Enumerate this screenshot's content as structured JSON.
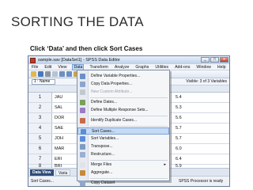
{
  "slide": {
    "title": "SORTING THE DATA",
    "subtitle": "Click ‘Data’ and then click Sort Cases"
  },
  "window": {
    "title": "sample.sav [DataSet1] - SPSS Data Editor",
    "controls": [
      "_",
      "□",
      "x"
    ]
  },
  "menubar": [
    "File",
    "Edit",
    "View",
    "Data",
    "Transform",
    "Analyze",
    "Graphs",
    "Utilities",
    "Add-ons",
    "Window",
    "Help"
  ],
  "active_menu": "Data",
  "cellref": {
    "value": "1 : Name",
    "visible": "Visible: 3 of 3 Variables"
  },
  "rows": [
    {
      "num": "1",
      "name": "JAU",
      "value": "5.4"
    },
    {
      "num": "2",
      "name": "SAL",
      "value": "5.3"
    },
    {
      "num": "3",
      "name": "DOR",
      "value": "5.6"
    },
    {
      "num": "4",
      "name": "SAE",
      "value": "5.7"
    },
    {
      "num": "5",
      "name": "JOH",
      "value": "5.7"
    },
    {
      "num": "6",
      "name": "MAR",
      "value": "6.0"
    },
    {
      "num": "7",
      "name": "ERI",
      "value": "6.4"
    },
    {
      "num": "8",
      "name": "BRI",
      "value": "5.9"
    }
  ],
  "data_menu": [
    {
      "label": "Define Variable Properties...",
      "disabled": false,
      "icon_color": "#6a8fc7"
    },
    {
      "label": "Copy Data Properties...",
      "disabled": false,
      "icon_color": "#8aa6d0"
    },
    {
      "label": "New Custom Attribute...",
      "disabled": true,
      "icon_color": "#c2c8d0"
    },
    {
      "label": "Define Dates...",
      "disabled": false,
      "icon_color": "#7aa05a"
    },
    {
      "label": "Define Multiple Response Sets...",
      "disabled": false,
      "icon_color": "#9b7bc2"
    },
    {
      "label": "Identify Duplicate Cases...",
      "disabled": false,
      "icon_color": "#c96a4a"
    },
    {
      "label": "Sort Cases...",
      "disabled": false,
      "icon_color": "#5b8dd6",
      "highlight": true
    },
    {
      "label": "Sort Variables...",
      "disabled": false,
      "icon_color": "#5b8dd6"
    },
    {
      "label": "Transpose...",
      "disabled": false,
      "icon_color": "#7d9bc4"
    },
    {
      "label": "Restructure...",
      "disabled": false,
      "icon_color": "#9bb0cf"
    },
    {
      "label": "Merge Files",
      "disabled": false,
      "icon_color": "#e0e4ea",
      "submenu": true
    },
    {
      "label": "Aggregate...",
      "disabled": false,
      "icon_color": "#c78a3a"
    },
    {
      "label": "Copy Dataset",
      "disabled": false,
      "icon_color": "#8fa8cc"
    }
  ],
  "submenu_arrow": "▸",
  "tabs": {
    "active": "Data View",
    "other": "Varia"
  },
  "status": {
    "left": "Sort Cases...",
    "right": "SPSS Processor is ready"
  },
  "colors": {
    "highlight": "#c5daf4",
    "active_tab": "#2f4c7a",
    "close": "#c0392b"
  }
}
